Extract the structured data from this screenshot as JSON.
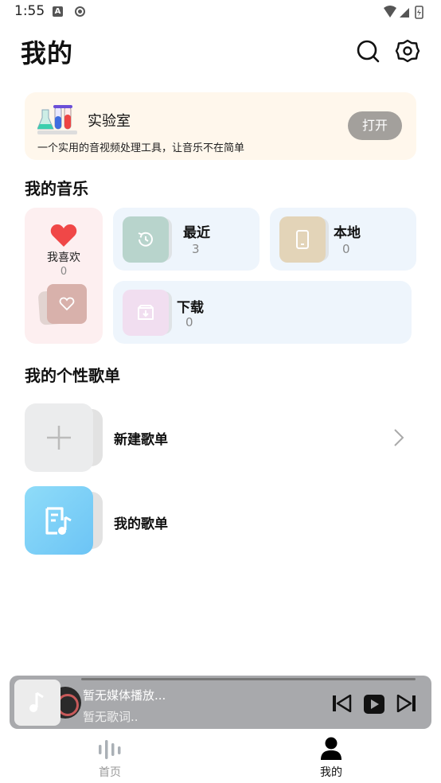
{
  "status_bar": {
    "time": "1:55",
    "a_badge": "A"
  },
  "header": {
    "title": "我的"
  },
  "lab": {
    "title": "实验室",
    "description": "一个实用的音视频处理工具，让音乐不在简单",
    "open_label": "打开"
  },
  "my_music": {
    "section_title": "我的音乐",
    "favorites": {
      "label": "我喜欢",
      "count": "0"
    },
    "recent": {
      "label": "最近",
      "count": "3"
    },
    "local": {
      "label": "本地",
      "count": "0"
    },
    "download": {
      "label": "下载",
      "count": "0"
    }
  },
  "playlists": {
    "section_title": "我的个性歌单",
    "items": [
      {
        "label": "新建歌单"
      },
      {
        "label": "我的歌单"
      }
    ]
  },
  "player": {
    "title": "暂无媒体播放...",
    "lyric": "暂无歌词.."
  },
  "bottom_nav": {
    "items": [
      {
        "label": "首页",
        "active": false
      },
      {
        "label": "我的",
        "active": true
      }
    ]
  },
  "colors": {
    "lab_bg": "#fff7ec",
    "fav_bg": "#fdeff0",
    "tile_bg": "#eef5fc",
    "heart": "#f04747",
    "player_bg": "#a8a9ac",
    "playlist_blue": "#7dd3f7"
  },
  "icons": {
    "search": "search-icon",
    "settings": "gear-icon",
    "recent": "clock-icon",
    "local": "phone-icon",
    "download": "download-box-icon",
    "new_playlist": "plus-icon",
    "my_playlist": "music-note-doc-icon",
    "previous": "skip-previous-icon",
    "play": "play-icon",
    "next": "skip-next-icon",
    "nav_home": "audio-bars-icon",
    "nav_mine": "person-icon"
  }
}
